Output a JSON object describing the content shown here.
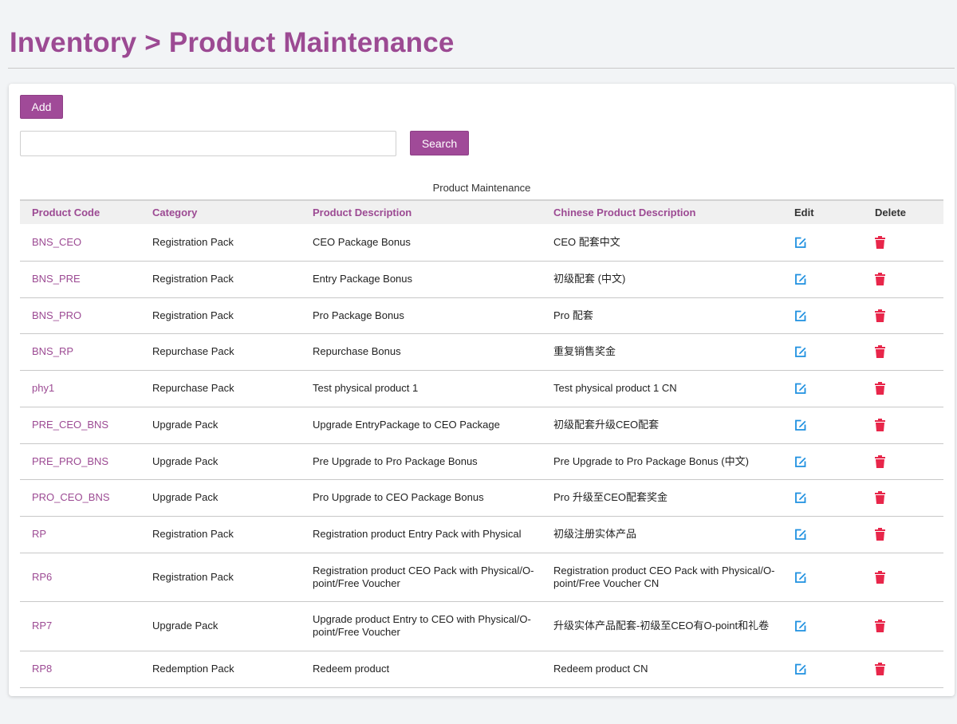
{
  "header": {
    "title": "Inventory > Product Maintenance"
  },
  "toolbar": {
    "add_label": "Add",
    "search_value": "",
    "search_placeholder": "",
    "search_label": "Search"
  },
  "table": {
    "caption": "Product Maintenance",
    "columns": [
      "Product Code",
      "Category",
      "Product Description",
      "Chinese Product Description",
      "Edit",
      "Delete"
    ],
    "rows": [
      {
        "code": "BNS_CEO",
        "category": "Registration Pack",
        "description": "CEO Package Bonus",
        "chinese": "CEO 配套中文"
      },
      {
        "code": "BNS_PRE",
        "category": "Registration Pack",
        "description": "Entry Package Bonus",
        "chinese": "初级配套 (中文)"
      },
      {
        "code": "BNS_PRO",
        "category": "Registration Pack",
        "description": "Pro Package Bonus",
        "chinese": "Pro 配套"
      },
      {
        "code": "BNS_RP",
        "category": "Repurchase Pack",
        "description": "Repurchase Bonus",
        "chinese": "重复销售奖金"
      },
      {
        "code": "phy1",
        "category": "Repurchase Pack",
        "description": "Test physical product 1",
        "chinese": "Test physical product 1 CN"
      },
      {
        "code": "PRE_CEO_BNS",
        "category": "Upgrade Pack",
        "description": "Upgrade EntryPackage to CEO Package",
        "chinese": "初级配套升级CEO配套"
      },
      {
        "code": "PRE_PRO_BNS",
        "category": "Upgrade Pack",
        "description": "Pre Upgrade to Pro Package Bonus",
        "chinese": "Pre Upgrade to Pro Package Bonus (中文)"
      },
      {
        "code": "PRO_CEO_BNS",
        "category": "Upgrade Pack",
        "description": "Pro Upgrade to CEO Package Bonus",
        "chinese": "Pro 升级至CEO配套奖金"
      },
      {
        "code": "RP",
        "category": "Registration Pack",
        "description": "Registration product Entry Pack with Physical",
        "chinese": "初级注册实体产品"
      },
      {
        "code": "RP6",
        "category": "Registration Pack",
        "description": "Registration product CEO Pack with Physical/O-point/Free Voucher",
        "chinese": "Registration product CEO Pack with Physical/O-point/Free Voucher CN"
      },
      {
        "code": "RP7",
        "category": "Upgrade Pack",
        "description": "Upgrade product Entry to CEO with Physical/O-point/Free Voucher",
        "chinese": "升级实体产品配套-初级至CEO有O-point和礼卷"
      },
      {
        "code": "RP8",
        "category": "Redemption Pack",
        "description": "Redeem product",
        "chinese": "Redeem product CN"
      }
    ]
  },
  "icons": {
    "edit": "edit-icon",
    "delete": "trash-icon"
  },
  "colors": {
    "accent": "#9c4a93",
    "button": "#a04a98",
    "edit_icon": "#1e90e0",
    "delete_icon": "#e8264a"
  }
}
